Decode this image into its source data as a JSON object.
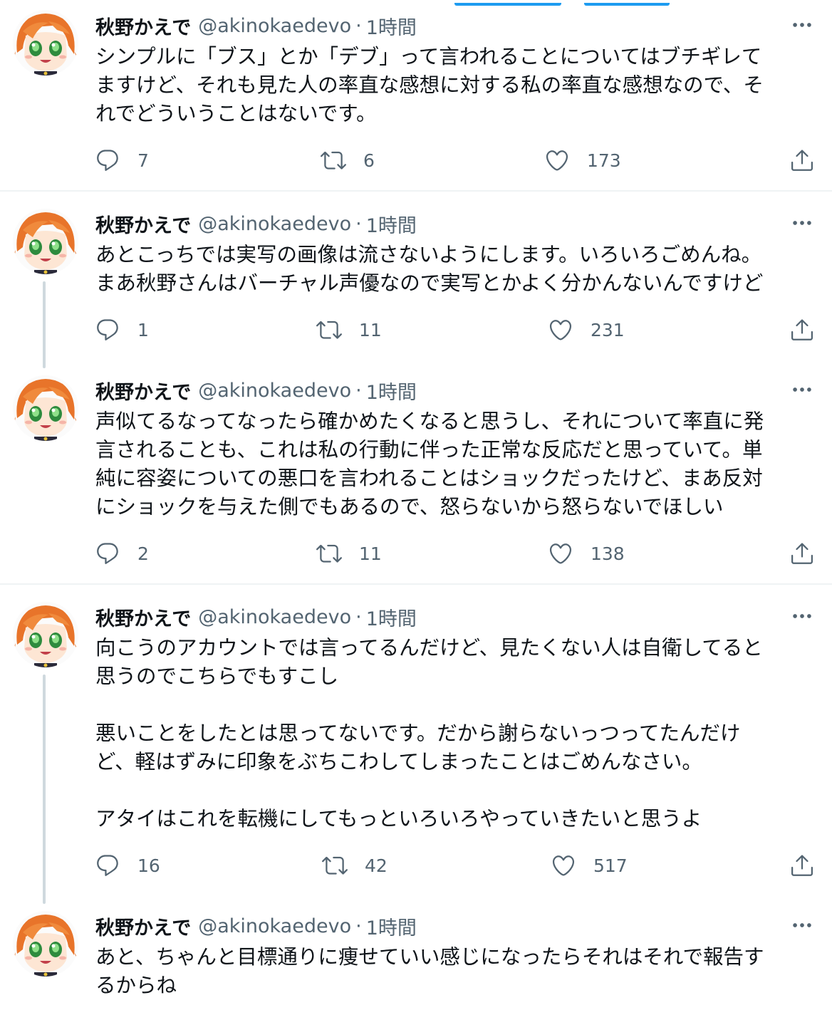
{
  "colors": {
    "accent": "#1d9bf0",
    "text": "#0f1419",
    "muted": "#536471",
    "divider": "#eff3f4",
    "thread": "#cfd9de"
  },
  "icons": {
    "more": "more-horizontal-icon",
    "reply": "reply-icon",
    "retweet": "retweet-icon",
    "like": "heart-icon",
    "share": "share-icon"
  },
  "tweets": [
    {
      "name": "秋野かえで",
      "handle": "@akinokaedevo",
      "separator": "·",
      "time": "1時間",
      "text": "シンプルに「ブス」とか「デブ」って言われることについてはブチギレて\nますけど、それも見た人の率直な感想に対する私の率直な感想なので、そ\nれでどういうことはないです。",
      "replies": "7",
      "retweets": "6",
      "likes": "173"
    },
    {
      "name": "秋野かえで",
      "handle": "@akinokaedevo",
      "separator": "·",
      "time": "1時間",
      "text": "あとこっちでは実写の画像は流さないようにします。いろいろごめんね。\nまあ秋野さんはバーチャル声優なので実写とかよく分かんないんですけど",
      "replies": "1",
      "retweets": "11",
      "likes": "231"
    },
    {
      "name": "秋野かえで",
      "handle": "@akinokaedevo",
      "separator": "·",
      "time": "1時間",
      "text": "声似てるなってなったら確かめたくなると思うし、それについて率直に発\n言されることも、これは私の行動に伴った正常な反応だと思っていて。単\n純に容姿についての悪口を言われることはショックだったけど、まあ反対\nにショックを与えた側でもあるので、怒らないから怒らないでほしい",
      "replies": "2",
      "retweets": "11",
      "likes": "138"
    },
    {
      "name": "秋野かえで",
      "handle": "@akinokaedevo",
      "separator": "·",
      "time": "1時間",
      "text": "向こうのアカウントでは言ってるんだけど、見たくない人は自衛してると\n思うのでこちらでもすこし\n\n悪いことをしたとは思ってないです。だから謝らないっつってたんだけ\nど、軽はずみに印象をぶちこわしてしまったことはごめんなさい。\n\nアタイはこれを転機にしてもっといろいろやっていきたいと思うよ",
      "replies": "16",
      "retweets": "42",
      "likes": "517"
    },
    {
      "name": "秋野かえで",
      "handle": "@akinokaedevo",
      "separator": "·",
      "time": "1時間",
      "text": "あと、ちゃんと目標通りに痩せていい感じになったらそれはそれで報告す\nるからね"
    }
  ]
}
